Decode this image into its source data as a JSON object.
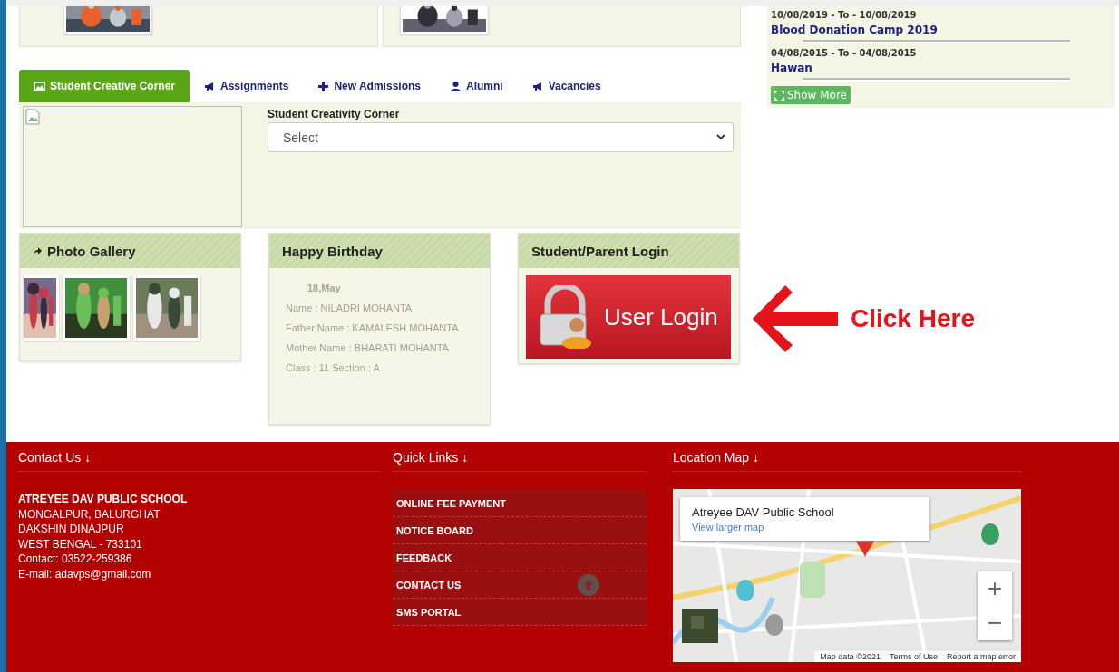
{
  "tabs": [
    {
      "kind": "picture",
      "label": "Student Creative Corner",
      "selected": true
    },
    {
      "kind": "megaphone",
      "label": "Assignments",
      "selected": false
    },
    {
      "kind": "plus",
      "label": "New Admissions",
      "selected": false
    },
    {
      "kind": "person",
      "label": "Alumni",
      "selected": false
    },
    {
      "kind": "megaphone",
      "label": "Vacancies",
      "selected": false
    }
  ],
  "creative_corner": {
    "label": "Student Creativity Corner",
    "select": "Select"
  },
  "events": [
    {
      "dates": "10/08/2019 - To - 10/08/2019",
      "title": "Blood Donation Camp 2019"
    },
    {
      "dates": "04/08/2015 - To - 04/08/2015",
      "title": "Hawan"
    }
  ],
  "show_more": "Show More",
  "photo_gallery": {
    "title": "Photo Gallery"
  },
  "birthday": {
    "title": "Happy Birthday",
    "date": "18,May",
    "lines": [
      "Name : NILADRI MOHANTA",
      "Father Name : KAMALESH MOHANTA",
      "Mother Name : BHARATI MOHANTA",
      "Class : 11 Section : A"
    ]
  },
  "login": {
    "title": "Student/Parent Login",
    "button": "User Login"
  },
  "annotation": {
    "label": "Click Here"
  },
  "footer": {
    "contact": {
      "heading": "Contact Us ↓",
      "name": "ATREYEE DAV PUBLIC SCHOOL",
      "lines": [
        "MONGALPUR, BALURGHAT",
        "DAKSHIN DINAJPUR",
        "WEST BENGAL - 733101",
        "Contact: 03522-259386",
        "E-mail: adavps@gmail.com"
      ]
    },
    "quick_links": {
      "heading": "Quick Links ↓",
      "links": [
        "ONLINE FEE PAYMENT",
        "NOTICE BOARD",
        "FEEDBACK",
        "CONTACT US",
        "SMS PORTAL"
      ]
    },
    "map": {
      "heading": "Location Map ↓",
      "place": "Atreyee DAV Public School",
      "link": "View larger map",
      "zoom_in": "+",
      "zoom_out": "−",
      "attribution": [
        "Map data ©2021",
        "Terms of Use",
        "Report a map error"
      ]
    }
  }
}
